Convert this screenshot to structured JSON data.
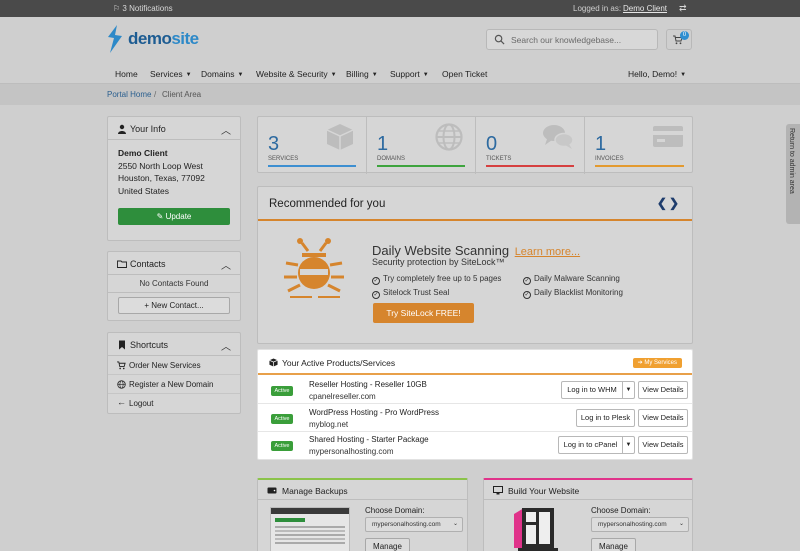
{
  "topbar": {
    "notifications": "3 Notifications",
    "logged_in_as": "Logged in as:",
    "client_name": "Demo Client"
  },
  "header": {
    "logo_text_demo": "demo",
    "logo_text_site": "site",
    "search_placeholder": "Search our knowledgebase...",
    "cart_count": "0"
  },
  "nav": {
    "items": [
      {
        "label": "Home",
        "caret": false
      },
      {
        "label": "Services",
        "caret": true
      },
      {
        "label": "Domains",
        "caret": true
      },
      {
        "label": "Website & Security",
        "caret": true
      },
      {
        "label": "Billing",
        "caret": true
      },
      {
        "label": "Support",
        "caret": true
      },
      {
        "label": "Open Ticket",
        "caret": false
      }
    ],
    "greeting": "Hello, Demo!"
  },
  "breadcrumb": {
    "home": "Portal Home",
    "separator": "/",
    "current": "Client Area"
  },
  "your_info": {
    "title": "Your Info",
    "name": "Demo Client",
    "address1": "2550 North Loop West",
    "address2": "Houston, Texas, 77092",
    "country": "United States",
    "update_label": "Update"
  },
  "contacts": {
    "title": "Contacts",
    "empty": "No Contacts Found",
    "new_label": "New Contact..."
  },
  "shortcuts": {
    "title": "Shortcuts",
    "items": [
      "Order New Services",
      "Register a New Domain",
      "Logout"
    ]
  },
  "stats": [
    {
      "value": "3",
      "label": "SERVICES",
      "color": "#3d8fd1"
    },
    {
      "value": "1",
      "label": "DOMAINS",
      "color": "#3ea43e"
    },
    {
      "value": "0",
      "label": "TICKETS",
      "color": "#d64040"
    },
    {
      "value": "1",
      "label": "INVOICES",
      "color": "#e39a2f"
    }
  ],
  "recommended": {
    "title": "Recommended for you",
    "arrows": "‹›",
    "product_title": "Daily Website Scanning",
    "learn_more": "Learn more...",
    "subtitle": "Security protection by SiteLock™",
    "features": [
      "Try completely free up to 5 pages",
      "Daily Malware Scanning",
      "Sitelock Trust Seal",
      "Daily Blacklist Monitoring"
    ],
    "cta": "Try SiteLock FREE!"
  },
  "products": {
    "title": "Your Active Products/Services",
    "my_services": "My Services",
    "rows": [
      {
        "status": "Active",
        "name": "Reseller Hosting - Reseller 10GB",
        "domain": "cpanelreseller.com",
        "login": "Log in to WHM",
        "has_dropdown": true,
        "details": "View Details"
      },
      {
        "status": "Active",
        "name": "WordPress Hosting - Pro WordPress",
        "domain": "myblog.net",
        "login": "Log in to Plesk",
        "has_dropdown": false,
        "details": "View Details"
      },
      {
        "status": "Active",
        "name": "Shared Hosting - Starter Package",
        "domain": "mypersonalhosting.com",
        "login": "Log in to cPanel",
        "has_dropdown": true,
        "details": "View Details"
      }
    ]
  },
  "backups": {
    "title": "Manage Backups",
    "choose_label": "Choose Domain:",
    "selected": "mypersonalhosting.com",
    "manage": "Manage"
  },
  "build": {
    "title": "Build Your Website",
    "choose_label": "Choose Domain:",
    "selected": "mypersonalhosting.com",
    "manage": "Manage"
  },
  "admin_tab": "Return to admin area",
  "colors": {
    "accent_blue": "#2d6aa0",
    "green": "#2e8e3c",
    "orange": "#d6852d",
    "backups_accent": "#8bc34a",
    "build_accent": "#e0338a"
  }
}
